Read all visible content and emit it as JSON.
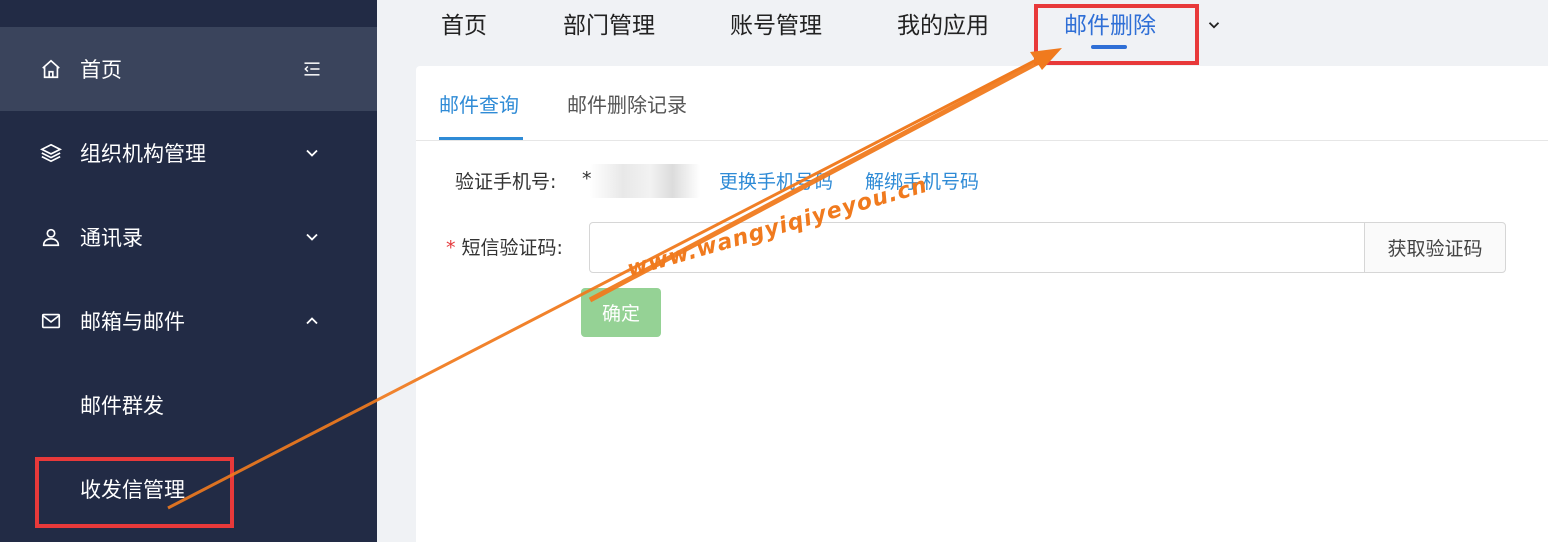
{
  "sidebar": {
    "items": [
      {
        "label": "首页",
        "icon": "home-icon",
        "active": true
      },
      {
        "label": "组织机构管理",
        "icon": "layers-icon",
        "expanded": false
      },
      {
        "label": "通讯录",
        "icon": "user-icon",
        "expanded": false
      },
      {
        "label": "邮箱与邮件",
        "icon": "mail-icon",
        "expanded": true
      }
    ],
    "subitems": [
      {
        "label": "邮件群发"
      },
      {
        "label": "收发信管理"
      }
    ],
    "collapse_icon": "menu-collapse-icon"
  },
  "topnav": {
    "tabs": [
      {
        "label": "首页"
      },
      {
        "label": "部门管理"
      },
      {
        "label": "账号管理"
      },
      {
        "label": "我的应用"
      },
      {
        "label": "邮件删除",
        "active": true
      }
    ],
    "more_icon": "chevron-down-icon"
  },
  "subtabs": [
    {
      "label": "邮件查询",
      "active": true
    },
    {
      "label": "邮件删除记录"
    }
  ],
  "form": {
    "phone_label": "验证手机号:",
    "phone_value": "*",
    "change_phone_link": "更换手机号码",
    "unbind_phone_link": "解绑手机号码",
    "sms_required_mark": "*",
    "sms_label": "短信验证码:",
    "sms_value": "",
    "get_code_button": "获取验证码",
    "confirm_button": "确定"
  },
  "watermark": "www.wangyiqiyeyou.cn",
  "colors": {
    "sidebar_bg": "#222b45",
    "sidebar_active": "#3a445c",
    "accent": "#2f6fd6",
    "link": "#2f8bd6",
    "confirm_bg": "#95d295",
    "annotation_red": "#e8393a",
    "annotation_orange": "#f07a1e"
  }
}
